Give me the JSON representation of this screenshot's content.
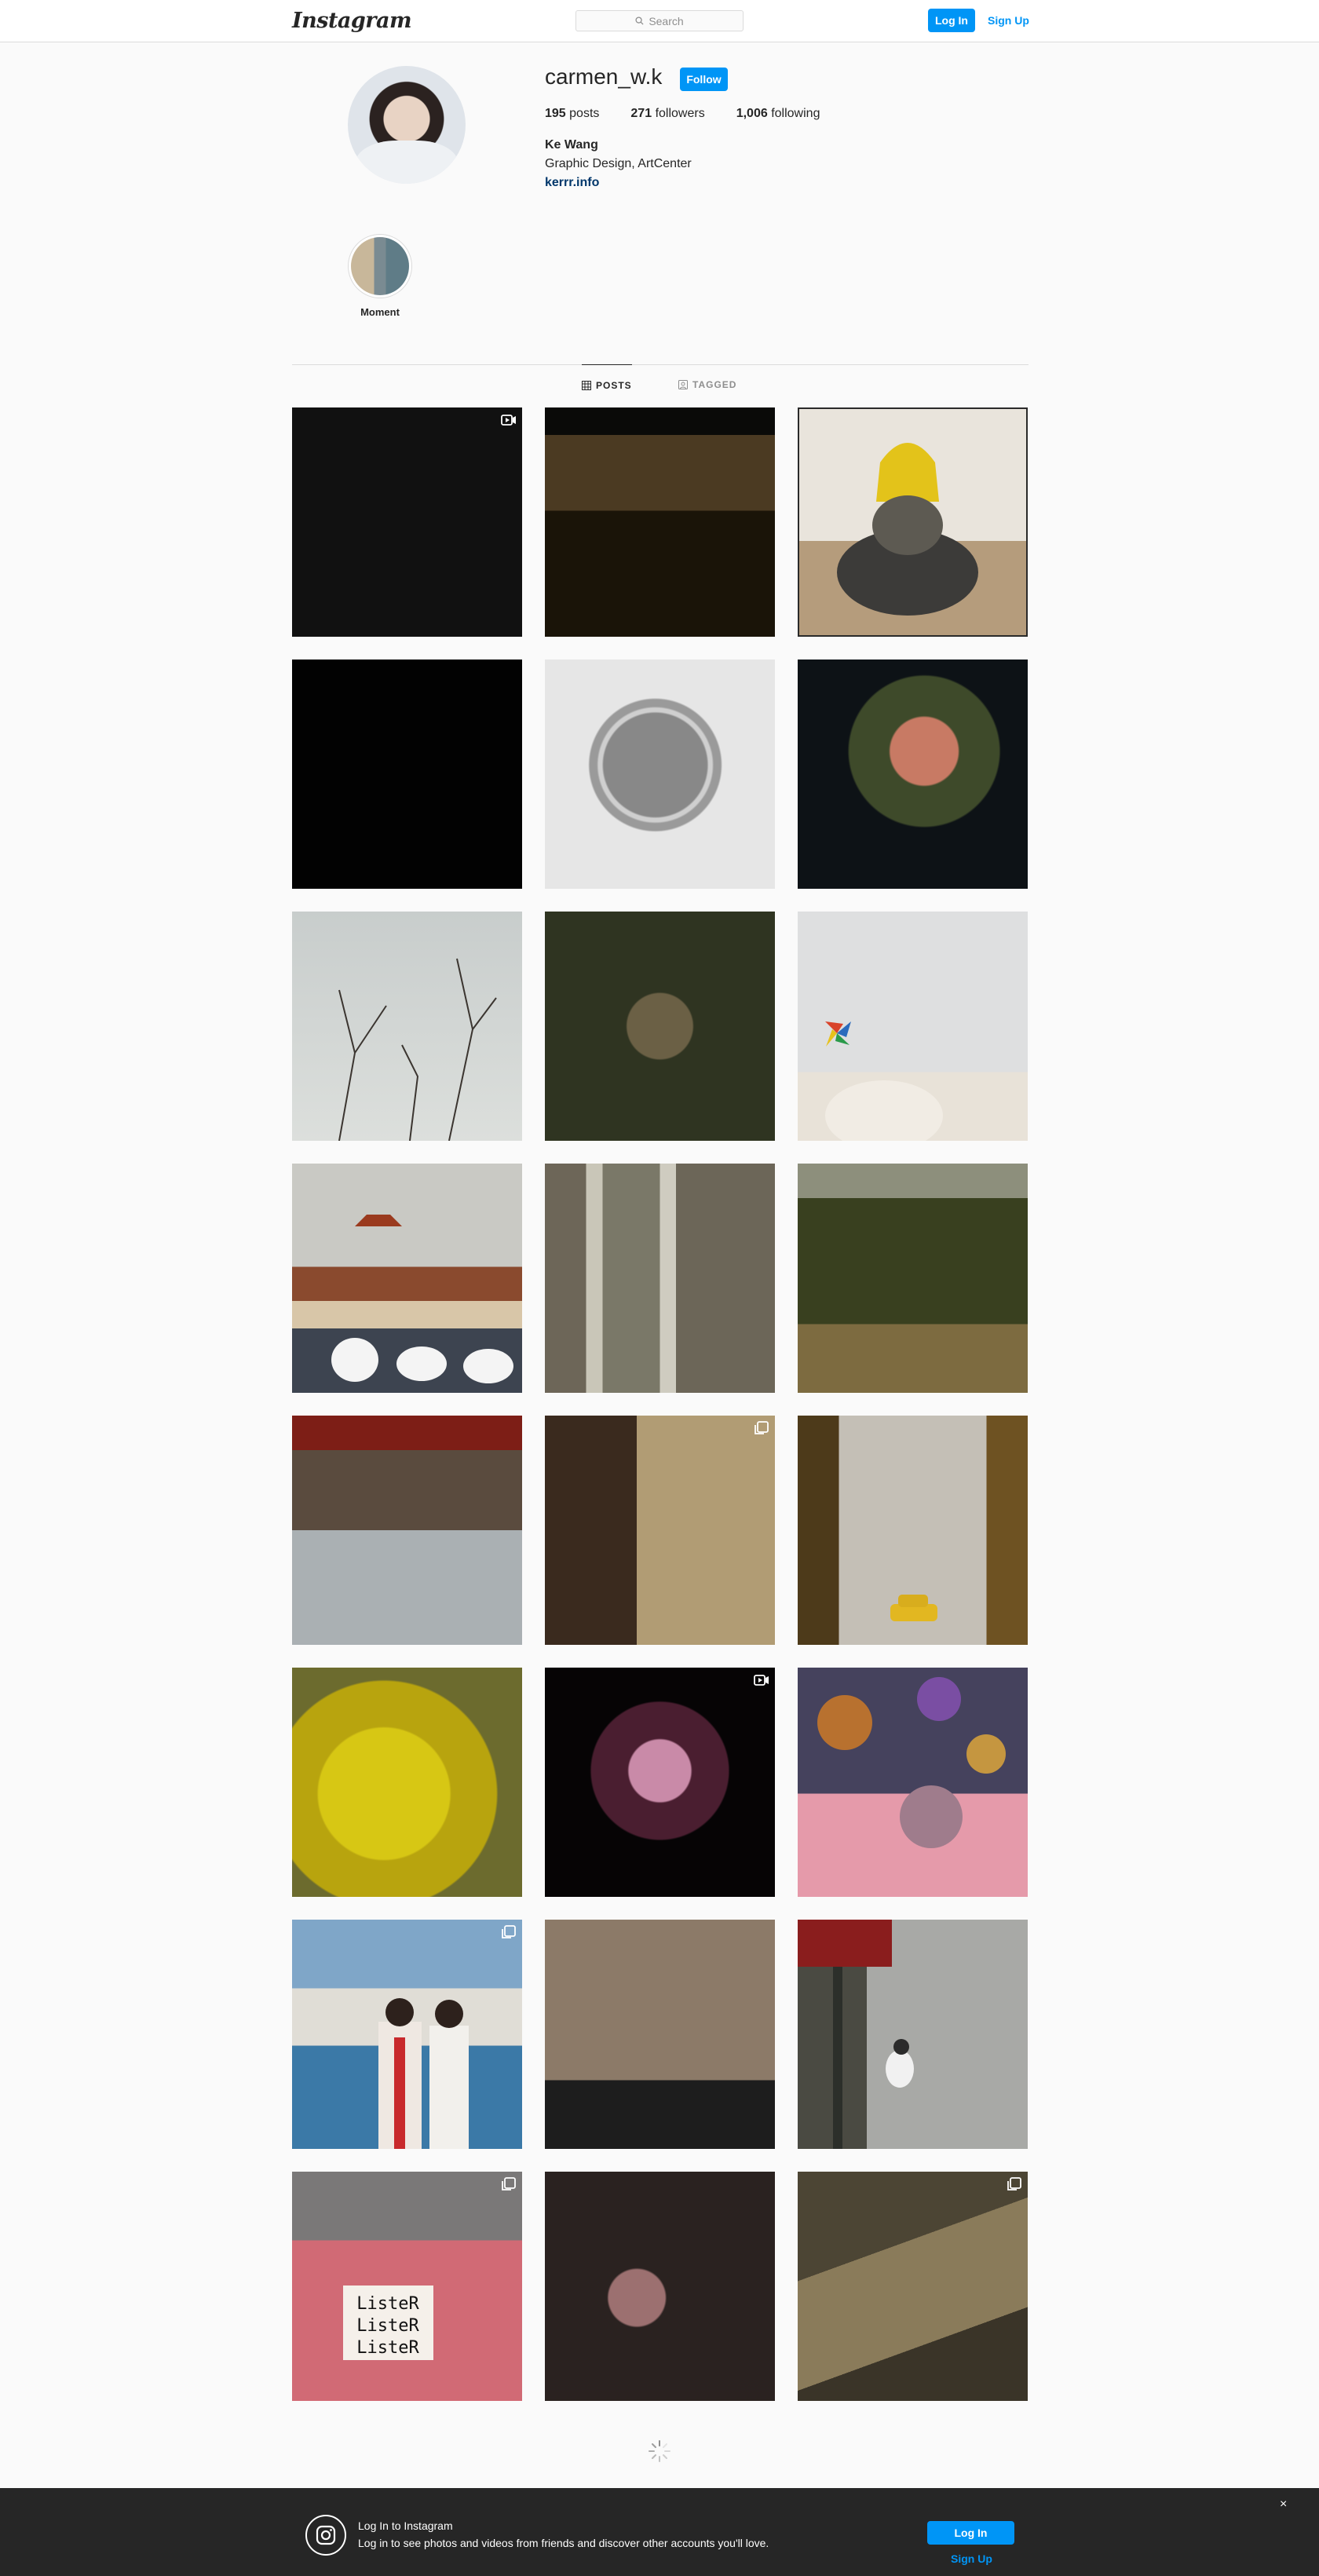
{
  "nav": {
    "logo": "Instagram",
    "search_placeholder": "Search",
    "login_label": "Log In",
    "signup_label": "Sign Up"
  },
  "profile": {
    "username": "carmen_w.k",
    "follow_label": "Follow",
    "posts_count": "195",
    "posts_label": "posts",
    "followers_count": "271",
    "followers_label": "followers",
    "following_count": "1,006",
    "following_label": "following",
    "full_name": "Ke Wang",
    "bio": "Graphic Design, ArtCenter",
    "website": "kerrr.info"
  },
  "highlights": [
    {
      "label": "Moment"
    }
  ],
  "tabs": {
    "posts": "POSTS",
    "tagged": "TAGGED"
  },
  "banner": {
    "title": "Log In to Instagram",
    "subtitle": "Log in to see photos and videos from friends and discover other accounts you'll love.",
    "login_label": "Log In",
    "signup_label": "Sign Up",
    "close": "×"
  },
  "posts": [
    {
      "badge": "video"
    },
    {
      "badge": ""
    },
    {
      "badge": ""
    },
    {
      "badge": ""
    },
    {
      "badge": ""
    },
    {
      "badge": ""
    },
    {
      "badge": ""
    },
    {
      "badge": ""
    },
    {
      "badge": ""
    },
    {
      "badge": ""
    },
    {
      "badge": ""
    },
    {
      "badge": ""
    },
    {
      "badge": ""
    },
    {
      "badge": "carousel"
    },
    {
      "badge": ""
    },
    {
      "badge": ""
    },
    {
      "badge": "video"
    },
    {
      "badge": ""
    },
    {
      "badge": "carousel"
    },
    {
      "badge": ""
    },
    {
      "badge": ""
    },
    {
      "badge": "carousel"
    },
    {
      "badge": ""
    },
    {
      "badge": "carousel"
    }
  ]
}
